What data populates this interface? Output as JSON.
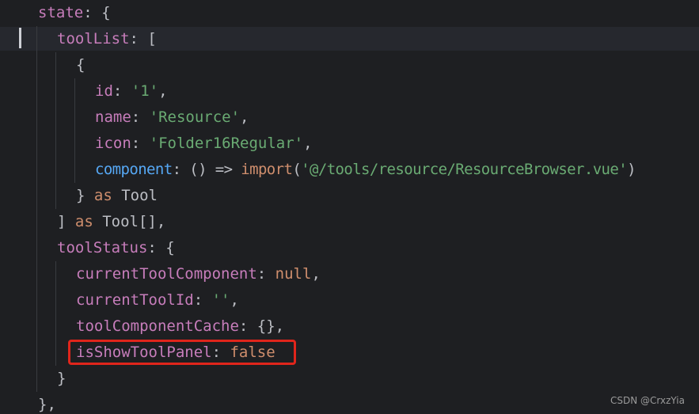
{
  "code": {
    "l1": {
      "key": "state",
      "punct": ": {"
    },
    "l2": {
      "key": "toolList",
      "punct": ": ["
    },
    "l3": {
      "punct": "{"
    },
    "l4": {
      "key": "id",
      "punct": ": ",
      "value": "'1'",
      "tail": ","
    },
    "l5": {
      "key": "name",
      "punct": ": ",
      "value": "'Resource'",
      "tail": ","
    },
    "l6": {
      "key": "icon",
      "punct": ": ",
      "value": "'Folder16Regular'",
      "tail": ","
    },
    "l7": {
      "key": "component",
      "punct": ": () => ",
      "fn": "import",
      "open": "(",
      "value": "'@/tools/resource/ResourceBrowser.vue'",
      "close": ")"
    },
    "l8": {
      "punct": "} ",
      "kw": "as",
      "type": " Tool"
    },
    "l9": {
      "punct": "] ",
      "kw": "as",
      "type": " Tool[],"
    },
    "l10": {
      "key": "toolStatus",
      "punct": ": {"
    },
    "l11": {
      "key": "currentToolComponent",
      "punct": ": ",
      "value": "null",
      "tail": ","
    },
    "l12": {
      "key": "currentToolId",
      "punct": ": ",
      "value": "''",
      "tail": ","
    },
    "l13": {
      "key": "toolComponentCache",
      "punct": ": {},"
    },
    "l14": {
      "key": "isShowToolPanel",
      "punct": ": ",
      "value": "false"
    },
    "l15": {
      "punct": "}"
    },
    "l16": {
      "punct": "},"
    }
  },
  "watermark": "CSDN @CrxzYia",
  "colors": {
    "background": "#1e1f22",
    "property": "#c77dbb",
    "function_key": "#56a8f5",
    "string": "#6aab73",
    "keyword": "#cf8e6d",
    "plain": "#bcbec4",
    "highlight_border": "#e0251b"
  }
}
